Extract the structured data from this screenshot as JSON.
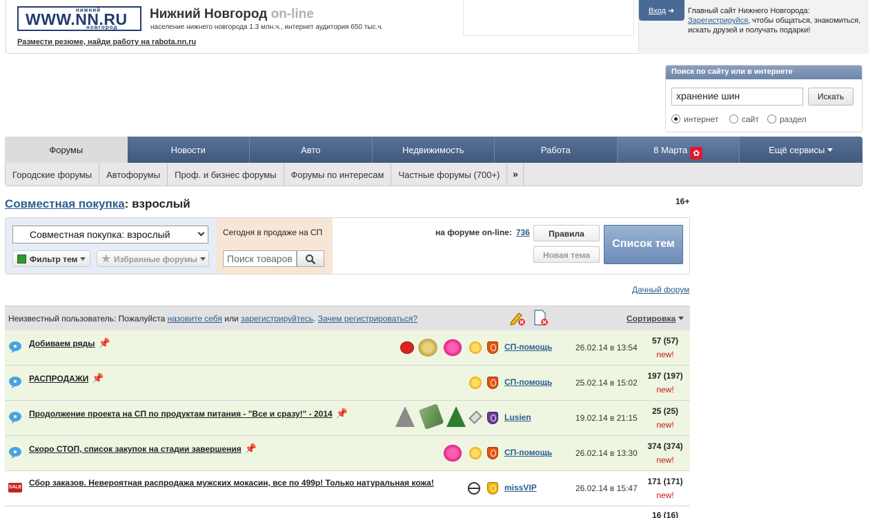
{
  "header": {
    "logo_small_top": "нижний",
    "logo_main": "WWW.NN.RU",
    "logo_small_bottom": "новгород",
    "title": "Нижний Новгород",
    "title_suffix": "on-line",
    "subtitle": "население нижнего новгорода 1.3 млн.ч., интернет аудитория 650 тыс.ч.",
    "job_link": "Размести резюме, найди работу на rabota.nn.ru"
  },
  "login": {
    "button": "Вход",
    "line1": "Главный сайт Нижнего Новгорода:",
    "register_link": "Зарегистрируйся",
    "line2": ", чтобы общаться, знакомиться, искать друзей и получать подарки!"
  },
  "search": {
    "header": "Поиск по сайту или в интернете",
    "value": "хранение шин",
    "button": "Искать",
    "options": [
      "интернет",
      "сайт",
      "раздел"
    ],
    "selected": "интернет"
  },
  "nav": {
    "items": [
      "Форумы",
      "Новости",
      "Авто",
      "Недвижимость",
      "Работа",
      "8 Марта",
      "Ещё сервисы"
    ],
    "active": "Форумы"
  },
  "subnav": {
    "items": [
      "Городские форумы",
      "Автофорумы",
      "Проф. и бизнес форумы",
      "Форумы по интересам",
      "Частные форумы (700+)"
    ],
    "more": "»"
  },
  "forum": {
    "title_link": "Совместная покупка",
    "title_rest": ": взрослый",
    "age": "16+",
    "select_value": "Совместная покупка: взрослый",
    "filter_btn": "Фильтр тем",
    "fav_btn": "Избранные форумы",
    "sale_label": "Сегодня в продаже на СП",
    "goods_placeholder": "Поиск товаров",
    "online_label": "на форуме on-line:",
    "online_count": "736",
    "rules_btn": "Правила",
    "newtopic_btn": "Новая тема",
    "topics_btn": "Список тем",
    "dacha_link": "Дачный форум"
  },
  "table_head": {
    "user_text": "Неизвестный пользователь: Пожалуйста",
    "login_link": "назовите себя",
    "or": "или",
    "register_link": "зарегистрируйтесь",
    "why_link": "Зачем регистрироваться?",
    "sort": "Сортировка"
  },
  "topics": [
    {
      "title": "Добиваем ряды",
      "pinned": true,
      "author": "СП-помощь",
      "date": "26.02.14 в 13:54",
      "count": "57 (57)",
      "new": "new!"
    },
    {
      "title": "РАСПРОДАЖИ",
      "pinned": true,
      "author": "СП-помощь",
      "date": "25.02.14 в 15:02",
      "count": "197 (197)",
      "new": "new!"
    },
    {
      "title": "Продолжение проекта на СП по продуктам питания - \"Все и сразу!\" - 2014",
      "pinned": true,
      "author": "Lusien",
      "date": "19.02.14 в 21:15",
      "count": "25 (25)",
      "new": "new!"
    },
    {
      "title": "Скоро СТОП, список закупок на стадии завершения",
      "pinned": true,
      "author": "СП-помощь",
      "date": "26.02.14 в 13:30",
      "count": "374 (374)",
      "new": "new!"
    },
    {
      "title": "Сбор заказов. Невероятная распродажа мужских мокасин, все по 499р! Только натуральная кожа!",
      "pinned": false,
      "author": "missVIP",
      "date": "26.02.14 в 15:47",
      "count": "171 (171)",
      "new": "new!"
    },
    {
      "count": "16 (16)"
    }
  ]
}
